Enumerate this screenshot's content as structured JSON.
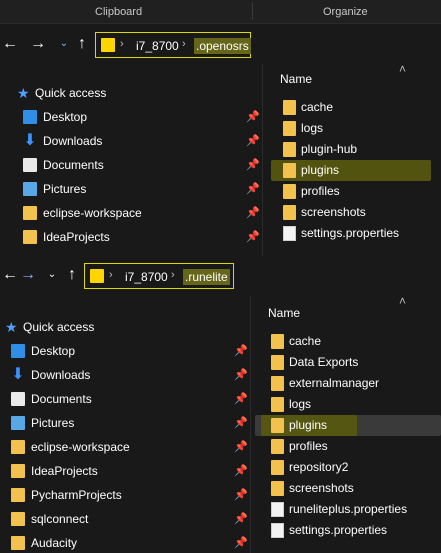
{
  "ribbon": {
    "groups": [
      "Clipboard",
      "Organize"
    ]
  },
  "window1": {
    "address": {
      "segments": [
        "i7_8700",
        ".openosrs"
      ]
    },
    "header": "Name",
    "quick_access": [
      {
        "label": "Quick access",
        "icon": "star-icon"
      },
      {
        "label": "Desktop",
        "icon": "desktop-icon",
        "pinned": true
      },
      {
        "label": "Downloads",
        "icon": "download-icon",
        "pinned": true
      },
      {
        "label": "Documents",
        "icon": "documents-icon",
        "pinned": true
      },
      {
        "label": "Pictures",
        "icon": "pictures-icon",
        "pinned": true
      },
      {
        "label": "eclipse-workspace",
        "icon": "folder-icon",
        "pinned": true
      },
      {
        "label": "IdeaProjects",
        "icon": "folder-icon",
        "pinned": true
      }
    ],
    "files": [
      {
        "name": "cache",
        "type": "folder"
      },
      {
        "name": "logs",
        "type": "folder"
      },
      {
        "name": "plugin-hub",
        "type": "folder"
      },
      {
        "name": "plugins",
        "type": "folder",
        "highlighted": true
      },
      {
        "name": "profiles",
        "type": "folder"
      },
      {
        "name": "screenshots",
        "type": "folder"
      },
      {
        "name": "settings.properties",
        "type": "file"
      }
    ]
  },
  "window2": {
    "address": {
      "segments": [
        "i7_8700",
        ".runelite"
      ]
    },
    "header": "Name",
    "quick_access": [
      {
        "label": "Quick access",
        "icon": "star-icon"
      },
      {
        "label": "Desktop",
        "icon": "desktop-icon",
        "pinned": true
      },
      {
        "label": "Downloads",
        "icon": "download-icon",
        "pinned": true
      },
      {
        "label": "Documents",
        "icon": "documents-icon",
        "pinned": true
      },
      {
        "label": "Pictures",
        "icon": "pictures-icon",
        "pinned": true
      },
      {
        "label": "eclipse-workspace",
        "icon": "folder-icon",
        "pinned": true
      },
      {
        "label": "IdeaProjects",
        "icon": "folder-icon",
        "pinned": true
      },
      {
        "label": "PycharmProjects",
        "icon": "folder-icon",
        "pinned": true
      },
      {
        "label": "sqlconnect",
        "icon": "folder-icon",
        "pinned": true
      },
      {
        "label": "Audacity",
        "icon": "folder-icon",
        "pinned": true
      }
    ],
    "files": [
      {
        "name": "cache",
        "type": "folder"
      },
      {
        "name": "Data Exports",
        "type": "folder"
      },
      {
        "name": "externalmanager",
        "type": "folder"
      },
      {
        "name": "logs",
        "type": "folder"
      },
      {
        "name": "plugins",
        "type": "folder",
        "highlighted": true
      },
      {
        "name": "profiles",
        "type": "folder"
      },
      {
        "name": "repository2",
        "type": "folder"
      },
      {
        "name": "screenshots",
        "type": "folder"
      },
      {
        "name": "runeliteplus.properties",
        "type": "file"
      },
      {
        "name": "settings.properties",
        "type": "file"
      }
    ]
  },
  "colors": {
    "highlight": "#dcd900",
    "folder": "#f2c14e",
    "accent": "#3b93ff"
  }
}
